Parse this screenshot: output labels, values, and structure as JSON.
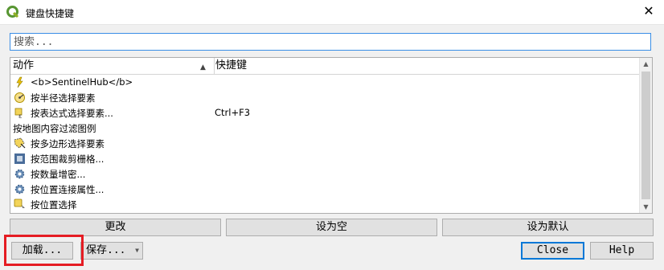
{
  "window": {
    "title": "键盘快捷键",
    "close_glyph": "✕"
  },
  "search": {
    "placeholder": "搜索..."
  },
  "table": {
    "headers": {
      "action": "动作",
      "shortcut": "快捷键"
    },
    "rows": [
      {
        "icon": "sentinelhub-icon",
        "name": "<b>SentinelHub</b>",
        "shortcut": ""
      },
      {
        "icon": "select-radius-icon",
        "name": "按半径选择要素",
        "shortcut": ""
      },
      {
        "icon": "select-expression-icon",
        "name": "按表达式选择要素...",
        "shortcut": "Ctrl+F3"
      },
      {
        "icon": "",
        "name": "按地图内容过滤图例",
        "shortcut": ""
      },
      {
        "icon": "select-polygon-icon",
        "name": "按多边形选择要素",
        "shortcut": ""
      },
      {
        "icon": "clip-raster-icon",
        "name": "按范围裁剪栅格...",
        "shortcut": ""
      },
      {
        "icon": "gear-icon",
        "name": "按数量增密...",
        "shortcut": ""
      },
      {
        "icon": "gear-icon",
        "name": "按位置连接属性...",
        "shortcut": ""
      },
      {
        "icon": "select-location-icon",
        "name": "按位置选择",
        "shortcut": ""
      }
    ]
  },
  "buttons": {
    "change": "更改",
    "set_none": "设为空",
    "set_default": "设为默认",
    "load": "加载...",
    "save": "保存...",
    "close": "Close",
    "help": "Help"
  }
}
